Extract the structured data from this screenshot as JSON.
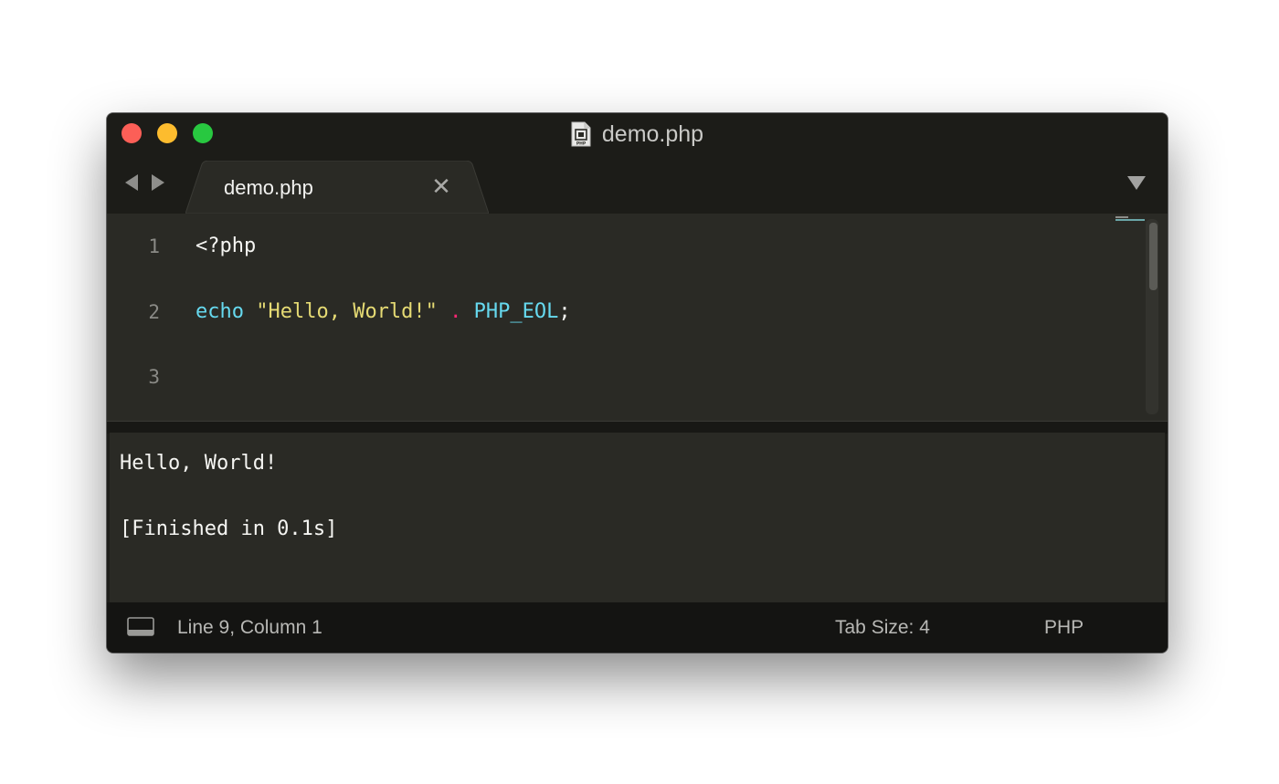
{
  "window": {
    "title": "demo.php",
    "file_icon_text": "PHP"
  },
  "tabbar": {
    "back_icon": "back-arrow-icon",
    "forward_icon": "forward-arrow-icon",
    "tabs": [
      {
        "label": "demo.php",
        "close_glyph": "✕",
        "active": true
      }
    ],
    "menu_icon": "triangle-down-icon"
  },
  "editor": {
    "line_numbers": [
      "1",
      "2",
      "3"
    ],
    "lines": [
      [
        {
          "text": "<?php",
          "kind": "plain"
        }
      ],
      [
        {
          "text": "echo",
          "kind": "keyword"
        },
        {
          "text": " ",
          "kind": "plain"
        },
        {
          "text": "\"Hello, World!\"",
          "kind": "string"
        },
        {
          "text": " ",
          "kind": "plain"
        },
        {
          "text": ".",
          "kind": "operator"
        },
        {
          "text": " ",
          "kind": "plain"
        },
        {
          "text": "PHP_EOL",
          "kind": "constant"
        },
        {
          "text": ";",
          "kind": "punctuation"
        }
      ],
      []
    ]
  },
  "output": {
    "lines": [
      "Hello, World!",
      "",
      "[Finished in 0.1s]"
    ]
  },
  "statusbar": {
    "panel_icon": "panel-toggle-icon",
    "position": "Line 9, Column 1",
    "tab_size": "Tab Size: 4",
    "syntax": "PHP"
  },
  "colors": {
    "close": "#fc5f57",
    "minimize": "#fdbc2e",
    "maximize": "#28c840",
    "keyword": "#66d9ef",
    "string": "#e6db74",
    "operator": "#f92672",
    "background": "#2a2a25"
  }
}
